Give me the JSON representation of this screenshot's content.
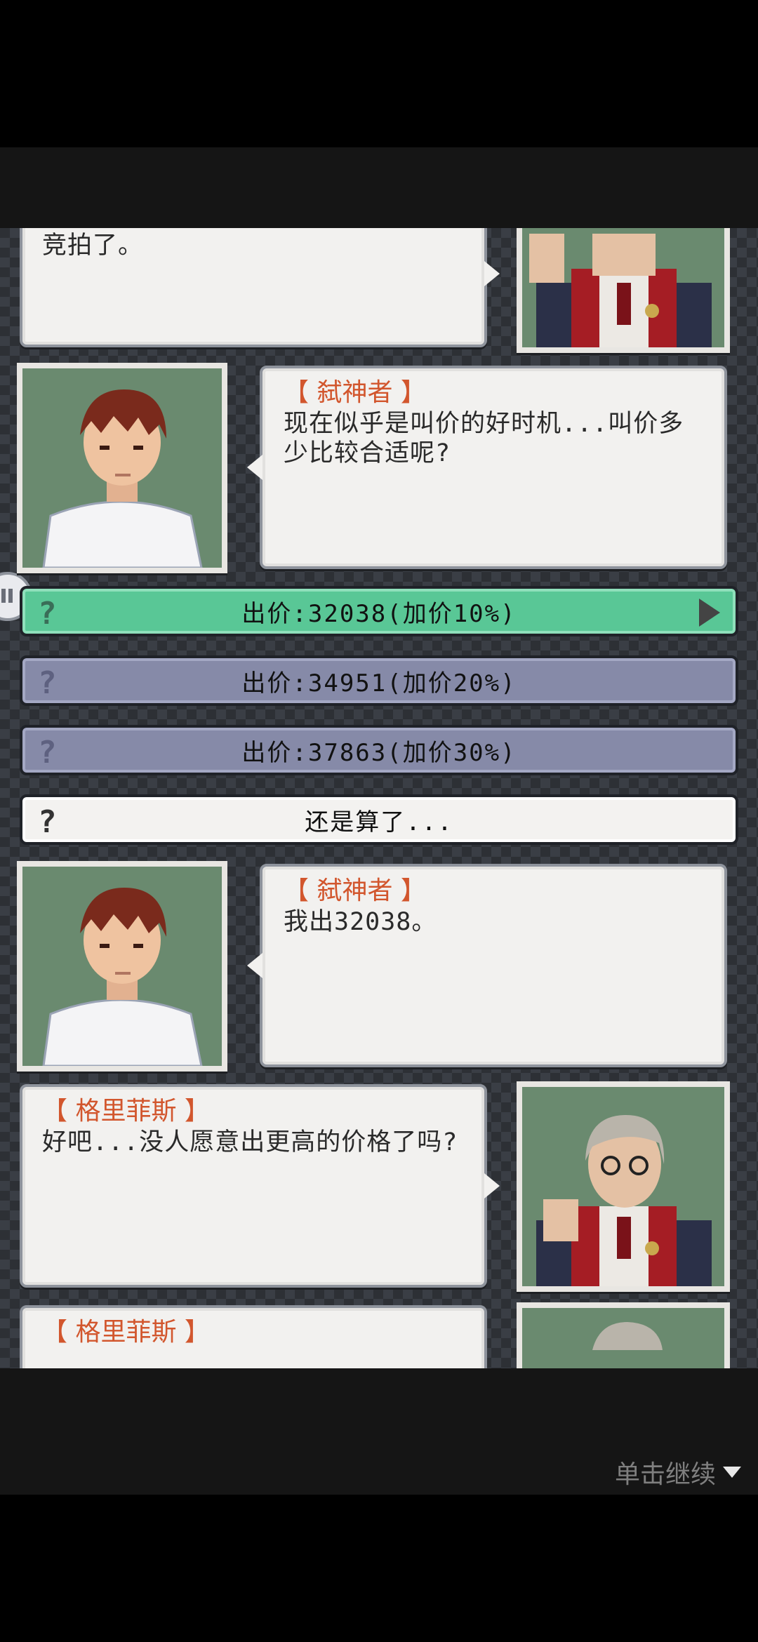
{
  "messages": [
    {
      "speaker": "",
      "text": "竞拍了。"
    },
    {
      "speaker": "【 弑神者 】",
      "text": "现在似乎是叫价的好时机...叫价多少比较合适呢?"
    },
    {
      "speaker": "【 弑神者 】",
      "text": "我出32038。"
    },
    {
      "speaker": "【 格里菲斯 】",
      "text": "好吧...没人愿意出更高的价格了吗?"
    },
    {
      "speaker": "【 格里菲斯 】",
      "text": ""
    }
  ],
  "choices": [
    {
      "icon": "?",
      "label": "出价:32038(加价10%)",
      "state": "selected"
    },
    {
      "icon": "?",
      "label": "出价:34951(加价20%)",
      "state": "normal"
    },
    {
      "icon": "?",
      "label": "出价:37863(加价30%)",
      "state": "normal"
    },
    {
      "icon": "?",
      "label": "还是算了...",
      "state": "cancel"
    }
  ],
  "footer": {
    "continue_label": "单击继续"
  },
  "colors": {
    "selected_choice": "#59c796",
    "option_choice": "#868aa8",
    "speaker_name": "#d2562d",
    "portrait_bg": "#6a8a6f"
  },
  "icons": {
    "question": "question-mark-icon",
    "arrow": "play-arrow-icon",
    "continue": "triangle-down-icon"
  }
}
